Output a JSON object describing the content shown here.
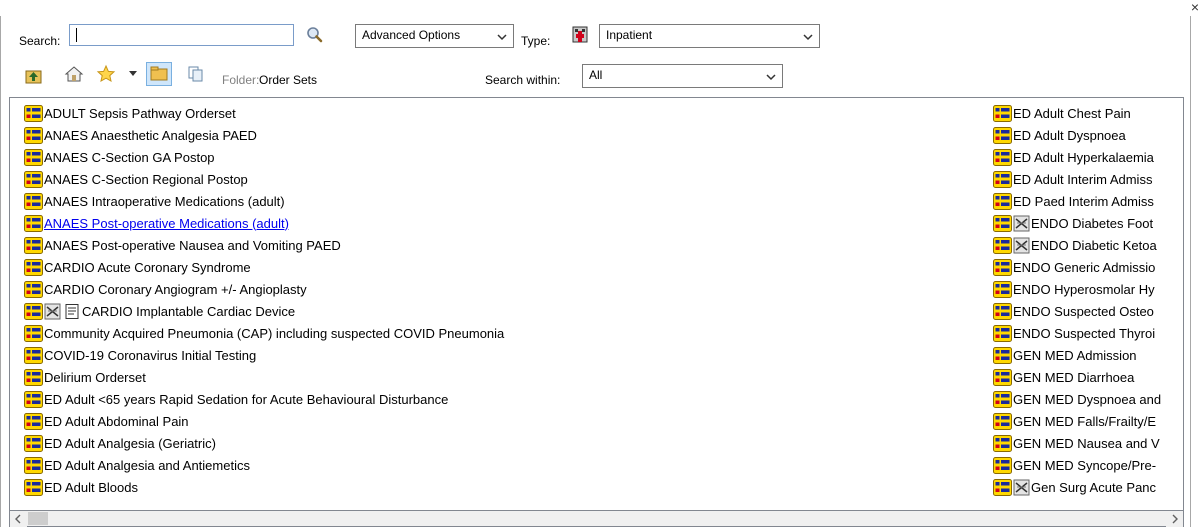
{
  "toolbar": {
    "search_label": "Search:",
    "search_value": "",
    "advanced_options": "Advanced Options",
    "type_label": "Type:",
    "type_value": "Inpatient",
    "folder_label": "Folder:",
    "folder_value": "Order Sets",
    "search_within_label": "Search within:",
    "search_within_value": "All"
  },
  "colors": {
    "link": "#0000ee",
    "orderset_icon_yellow": "#ffd800",
    "orderset_icon_blue": "#1a2a9c",
    "orderset_icon_red": "#d0021b"
  },
  "list": {
    "column1": [
      {
        "label": "ADULT Sepsis Pathway Orderset"
      },
      {
        "label": "ANAES Anaesthetic Analgesia PAED"
      },
      {
        "label": "ANAES C-Section GA Postop"
      },
      {
        "label": "ANAES C-Section Regional Postop"
      },
      {
        "label": "ANAES Intraoperative Medications (adult)"
      },
      {
        "label": "ANAES Post-operative Medications (adult)"
      },
      {
        "label": "ANAES Post-operative Nausea and Vomiting PAED"
      },
      {
        "label": "CARDIO Acute Coronary Syndrome"
      },
      {
        "label": "CARDIO Coronary Angiogram +/- Angioplasty"
      },
      {
        "label": "CARDIO Implantable Cardiac Device"
      },
      {
        "label": "Community Acquired Pneumonia (CAP) including suspected COVID Pneumonia"
      },
      {
        "label": "COVID-19 Coronavirus Initial Testing"
      },
      {
        "label": "Delirium Orderset"
      },
      {
        "label": "ED Adult <65 years Rapid Sedation for Acute Behavioural Disturbance"
      },
      {
        "label": "ED Adult Abdominal Pain"
      },
      {
        "label": "ED Adult Analgesia (Geriatric)"
      },
      {
        "label": "ED Adult Analgesia and Antiemetics"
      },
      {
        "label": "ED Adult Bloods"
      }
    ],
    "column2": [
      {
        "label": "ED Adult Chest Pain"
      },
      {
        "label": "ED Adult Dyspnoea"
      },
      {
        "label": "ED Adult Hyperkalaemia"
      },
      {
        "label": "ED Adult Interim Admiss"
      },
      {
        "label": "ED Paed Interim Admiss"
      },
      {
        "label": "ENDO Diabetes Foot"
      },
      {
        "label": "ENDO Diabetic Ketoa"
      },
      {
        "label": "ENDO Generic Admissio"
      },
      {
        "label": "ENDO Hyperosmolar Hy"
      },
      {
        "label": "ENDO Suspected Osteo"
      },
      {
        "label": "ENDO Suspected Thyroi"
      },
      {
        "label": "GEN MED Admission"
      },
      {
        "label": "GEN MED Diarrhoea"
      },
      {
        "label": "GEN MED Dyspnoea and"
      },
      {
        "label": "GEN MED Falls/Frailty/E"
      },
      {
        "label": "GEN MED Nausea and V"
      },
      {
        "label": "GEN MED Syncope/Pre-"
      },
      {
        "label": "Gen Surg Acute Panc"
      }
    ]
  }
}
